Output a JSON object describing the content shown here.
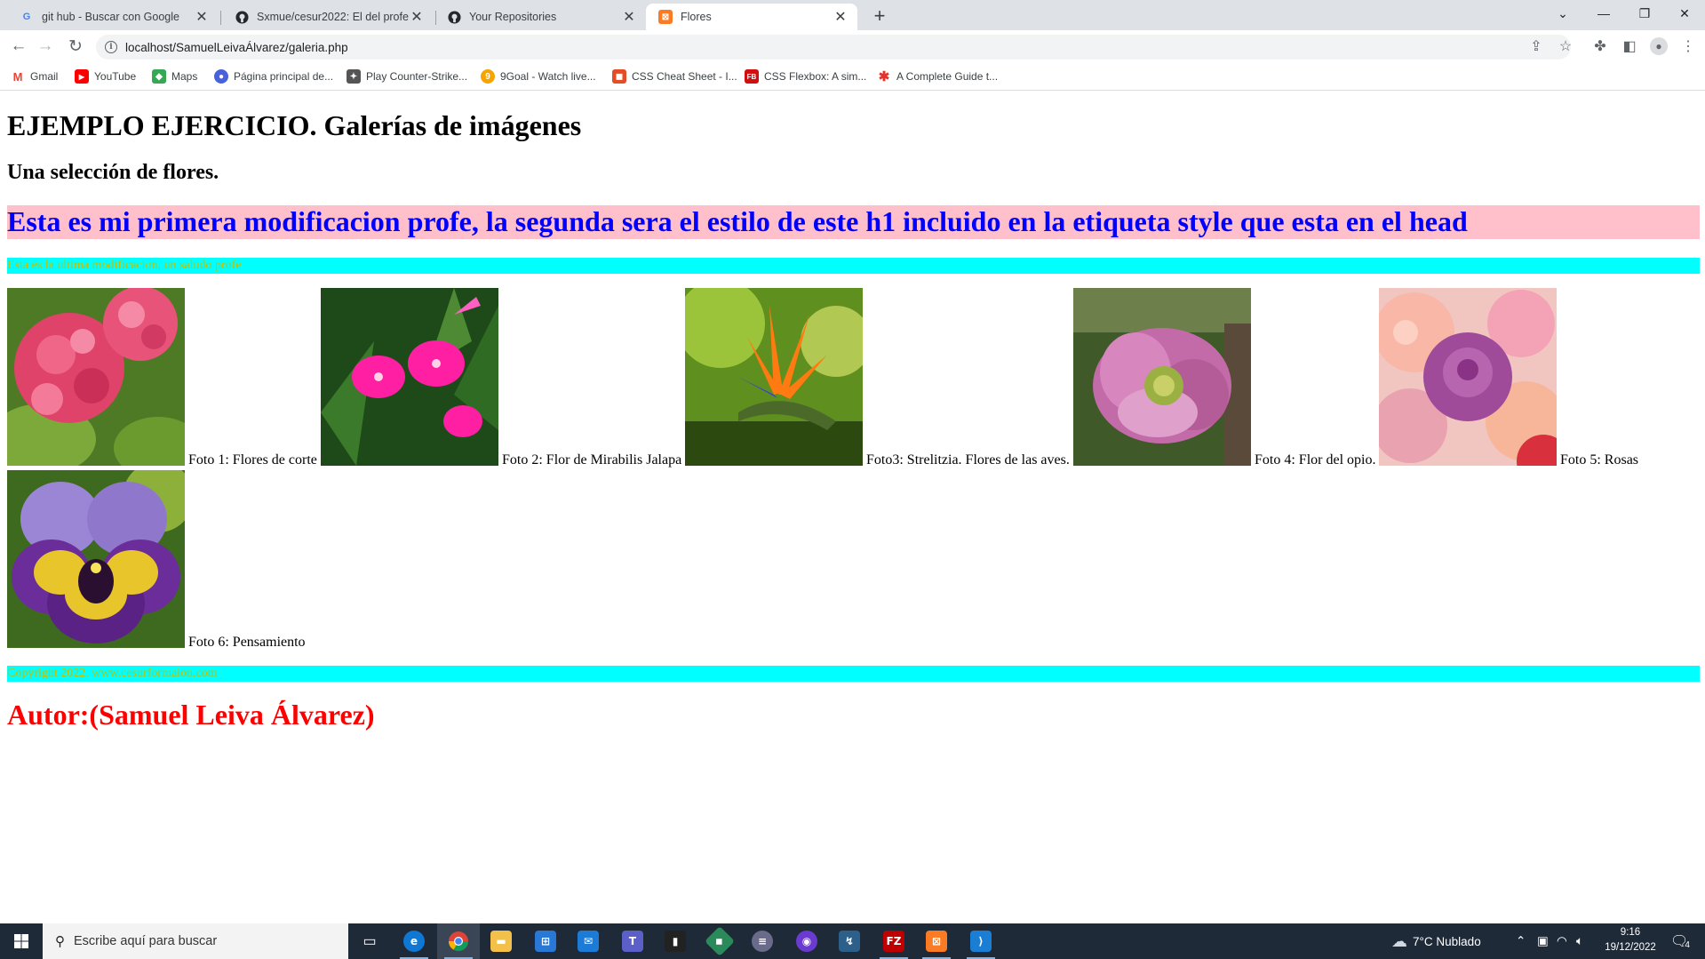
{
  "browser": {
    "tabs": [
      {
        "title": "git hub - Buscar con Google",
        "icon": "google-icon"
      },
      {
        "title": "Sxmue/cesur2022: El del profe",
        "icon": "github-icon"
      },
      {
        "title": "Your Repositories",
        "icon": "github-icon"
      },
      {
        "title": "Flores",
        "icon": "xampp-icon",
        "active": true
      }
    ],
    "url": "localhost/SamuelLeivaÁlvarez/galeria.php",
    "bookmarks": [
      {
        "label": "Gmail",
        "icon": "gmail-icon",
        "color": "#ea4335"
      },
      {
        "label": "YouTube",
        "icon": "youtube-icon",
        "color": "#ff0000"
      },
      {
        "label": "Maps",
        "icon": "maps-icon",
        "color": "#34a853"
      },
      {
        "label": "Página principal de...",
        "icon": "app-icon",
        "color": "#4a62d9"
      },
      {
        "label": "Play Counter-Strike...",
        "icon": "cs-icon",
        "color": "#555555"
      },
      {
        "label": "9Goal - Watch live...",
        "icon": "9goal-icon",
        "color": "#f5a400"
      },
      {
        "label": "CSS Cheat Sheet - I...",
        "icon": "css-icon",
        "color": "#e44d26"
      },
      {
        "label": "CSS Flexbox: A sim...",
        "icon": "fb-icon",
        "color": "#d20f0f"
      },
      {
        "label": "A Complete Guide t...",
        "icon": "asterisk-icon",
        "color": "#e0342c"
      }
    ]
  },
  "page": {
    "title": "EJEMPLO EJERCICIO. Galerías de imágenes",
    "subtitle": "Una selección de flores.",
    "banner": "Esta es mi primera modificacion profe, la segunda sera el estilo de este h1 incluido en la etiqueta style que esta en el head",
    "notice": "Esta es la ultima modificacion, un saludo profe",
    "photos": [
      {
        "caption": "Foto 1: Flores de corte",
        "subject": "hydrangea"
      },
      {
        "caption": "Foto 2: Flor de Mirabilis Jalapa",
        "subject": "mirabilis"
      },
      {
        "caption": "Foto3: Strelitzia. Flores de las aves.",
        "subject": "strelitzia"
      },
      {
        "caption": "Foto 4: Flor del opio.",
        "subject": "poppy"
      },
      {
        "caption": "Foto 5: Rosas",
        "subject": "roses"
      },
      {
        "caption": "Foto 6: Pensamiento",
        "subject": "pansy"
      }
    ],
    "footer": "Copyright 2022. www.cesurformaion.com",
    "author": "Autor:(Samuel Leiva Álvarez)"
  },
  "taskbar": {
    "search_placeholder": "Escribe aquí para buscar",
    "weather": "7°C  Nublado",
    "time": "9:16",
    "date": "19/12/2022",
    "notifications": "4"
  }
}
